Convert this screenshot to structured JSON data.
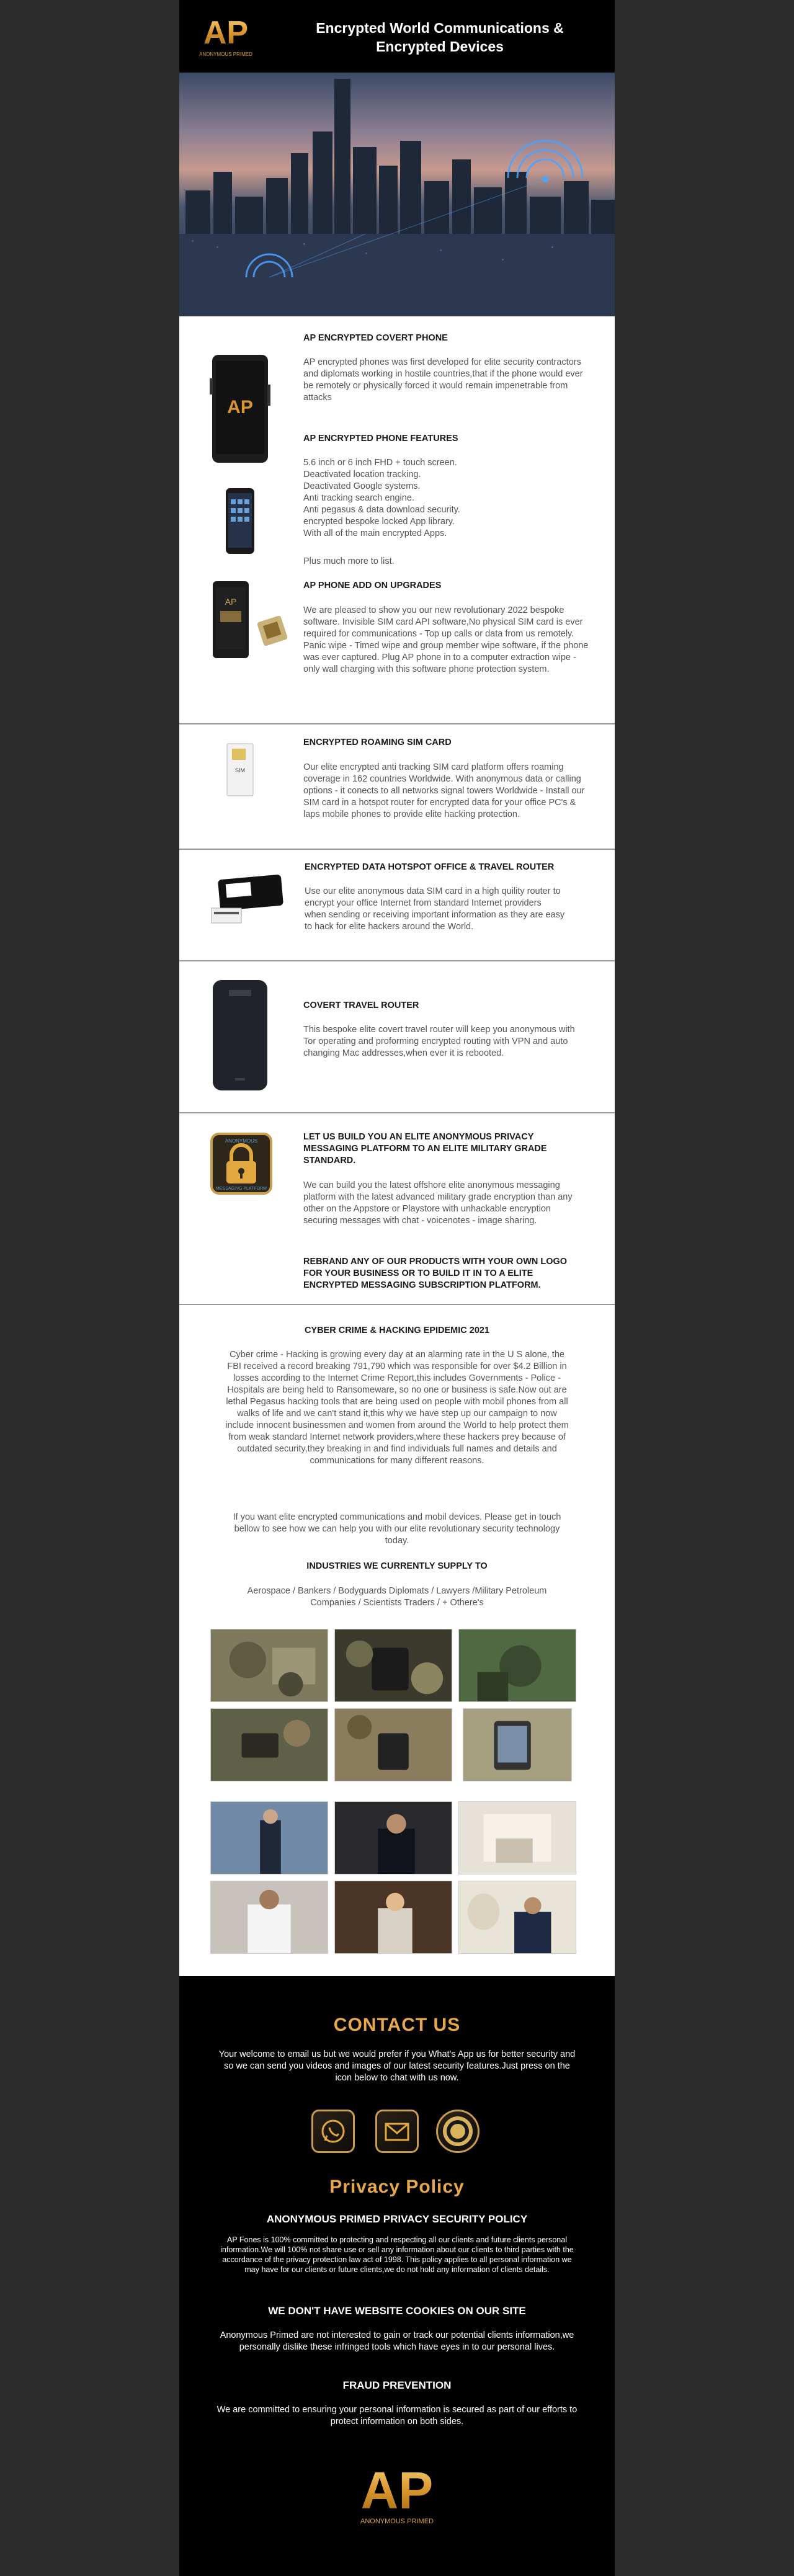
{
  "header": {
    "logo_text": "AP",
    "logo_sub": "ANONYMOUS PRIMED",
    "title": "Encrypted World Communications & Encrypted Devices"
  },
  "covert_phone": {
    "heading": "AP ENCRYPTED COVERT PHONE",
    "body": "AP encrypted phones was first developed for elite security contractors and diplomats working in hostile countries,that if the phone would ever be remotely or physically forced it would remain impenetrable from attacks"
  },
  "features": {
    "heading": "AP ENCRYPTED PHONE FEATURES",
    "lines": [
      "5.6 inch or 6 inch FHD + touch screen.",
      "Deactivated location tracking.",
      "Deactivated Google systems.",
      "Anti tracking search engine.",
      "Anti pegasus & data download security.",
      "encrypted bespoke locked App library.",
      "With all of the main encrypted Apps."
    ],
    "more": "Plus much more to list."
  },
  "upgrades": {
    "heading": "AP PHONE ADD ON UPGRADES",
    "body": "We are pleased to show you our new revolutionary 2022 bespoke software. Invisible SIM card API software,No physical SIM card is ever required for communications - Top up calls or data from us remotely. Panic wipe - Timed wipe and group member wipe software, if the phone was ever captured. Plug AP phone in to a computer extraction wipe - only wall charging with this software phone protection system."
  },
  "sim": {
    "heading": "ENCRYPTED ROAMING SIM CARD",
    "body": "Our elite encrypted anti tracking SIM card platform offers roaming coverage in 162 countries Worldwide. With anonymous data or calling options - it conects to all networks signal towers Worldwide - Install our SIM card in a hotspot router for encrypted data for your office PC's & laps mobile phones to provide elite hacking protection."
  },
  "hotspot": {
    "heading": "ENCRYPTED DATA HOTSPOT OFFICE & TRAVEL ROUTER",
    "body": "Use our elite anonymous data SIM card in a high quility router to encrypt your office Internet from standard Internet providers when sending or receiving important information as they are easy to hack for elite hackers around the World."
  },
  "router": {
    "heading": "COVERT TRAVEL ROUTER",
    "body": "This bespoke elite covert travel router will keep you anonymous with Tor operating and proforming encrypted routing with VPN and auto changing Mac addresses,when ever it is rebooted."
  },
  "messaging": {
    "lock_label_top": "ANONYMOUS",
    "lock_label_bottom": "MESSAGING PLATFORM",
    "heading": "LET US BUILD YOU AN ELITE ANONYMOUS PRIVACY MESSAGING PLATFORM TO AN ELITE MILITARY GRADE STANDARD.",
    "body": "We can build you the latest offshore elite anonymous messaging platform with the latest advanced military grade encryption than any other on the Appstore or Playstore with unhackable encryption securing messages with chat - voicenotes - image sharing.",
    "rebrand": "REBRAND ANY OF OUR PRODUCTS WITH YOUR OWN LOGO FOR YOUR BUSINESS OR TO BUILD IT IN TO A ELITE ENCRYPTED MESSAGING SUBSCRIPTION PLATFORM."
  },
  "cyber": {
    "heading": "CYBER CRIME & HACKING EPIDEMIC 2021",
    "body": "Cyber crime - Hacking is growing every day at an alarming rate in the U S alone, the FBI received a record breaking 791,790 which was responsible for over $4.2 Billion in losses according to the Internet Crime Report,this includes Governments - Police - Hospitals are being held to Ransomeware, so no one or business is safe.Now out are lethal Pegasus hacking tools that are being used on people with mobil phones from all walks of life and we can't stand it,this why we have step up our campaign to now include innocent businessmen and women from around the World to help protect them from weak standard Internet network providers,where these hackers prey because of outdated security,they breaking in and find individuals full names and details and communications for many different reasons.",
    "cta": "If you want elite encrypted communications and mobil devices. Please get in touch bellow to see how we can help you with our elite revolutionary security technology today."
  },
  "industries": {
    "heading": "INDUSTRIES WE CURRENTLY SUPPLY TO",
    "body": "Aerospace / Bankers / Bodyguards Diplomats / Lawyers /Military Petroleum Companies / Scientists Traders / + Othere's"
  },
  "contact": {
    "title": "CONTACT US",
    "body": "Your welcome to email us but we would prefer if you What's App us for better security and so we can send you videos and images of our latest security features.Just press on the icon below to chat with us now."
  },
  "privacy": {
    "title": "Privacy Policy",
    "policy_heading": "ANONYMOUS PRIMED PRIVACY SECURITY POLICY",
    "policy_body": "AP Fones is 100% committed to protecting and respecting all our clients and future clients personal information.We will 100% not share use or sell any information about our clients to third parties with the accordance of the privacy protection law act of 1998. This policy applies to all personal information we may have for our clients or future clients,we do not hold any information of clients details.",
    "cookies_heading": "WE DON'T HAVE WEBSITE COOKIES ON OUR SITE",
    "cookies_body": "Anonymous Primed are not interested to gain or track our potential clients information,we personally dislike these infringed tools which have eyes in to our personal lives.",
    "fraud_heading": "FRAUD PREVENTION",
    "fraud_body": "We are committed to ensuring your personal information is secured as part of our efforts to protect information on both sides."
  },
  "footer_logo": {
    "text": "AP",
    "sub": "ANONYMOUS PRIMED"
  },
  "colors": {
    "gold": "#e8a94c",
    "black": "#000000",
    "side": "#2c2c2d"
  }
}
